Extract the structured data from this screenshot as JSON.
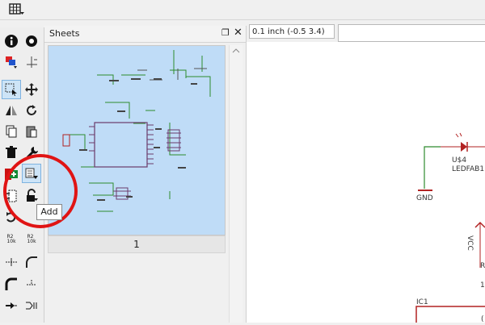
{
  "sheets_panel": {
    "title": "Sheets",
    "float_icon": "❐",
    "close_icon": "✕",
    "thumbnail_label": "1"
  },
  "coordinates": "0.1 inch (-0.5 3.4)",
  "command_input": {
    "value": "",
    "placeholder": ""
  },
  "tooltip": "Add",
  "schematic": {
    "led_name": "U$4",
    "led_value": "LEDFAB1",
    "gnd_label": "GND",
    "vcc_label": "VCC",
    "ic_label": "IC1",
    "partial_r": "R",
    "partial_one": "1",
    "partial_paren": "("
  },
  "tool_labels": {
    "r2_a": "R2",
    "r2_a_val": "10k",
    "r2_b": "R2",
    "r2_b_val": "10k"
  },
  "colors": {
    "highlight_ring": "#e01414",
    "thumbnail_bg": "#bfdcf7",
    "net_green": "#2e8b2e",
    "part_red": "#b22222"
  }
}
